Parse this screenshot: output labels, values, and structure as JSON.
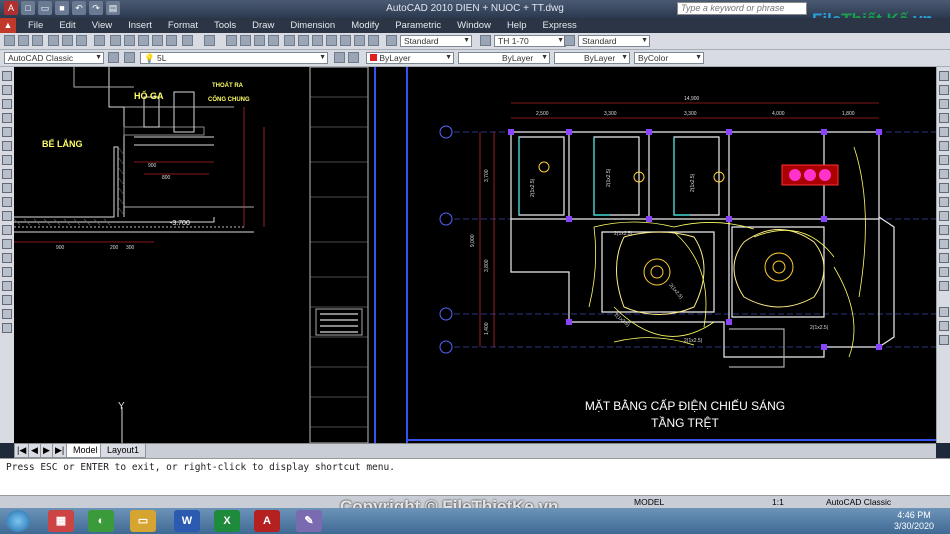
{
  "window": {
    "title": "AutoCAD 2010    DIEN + NUOC + TT.dwg",
    "search_placeholder": "Type a keyword or phrase",
    "logo_part1": "File",
    "logo_part2": "Thiết Kế",
    "logo_part3": ".vn"
  },
  "menu": {
    "items": [
      "File",
      "Edit",
      "View",
      "Insert",
      "Format",
      "Tools",
      "Draw",
      "Dimension",
      "Modify",
      "Parametric",
      "Window",
      "Help",
      "Express"
    ]
  },
  "toolbar2": {
    "text_style": "Standard",
    "dim_style": "TH 1-70",
    "table_style": "Standard"
  },
  "toolbar3": {
    "workspace": "AutoCAD Classic",
    "layer": "5L",
    "color": "ByLayer",
    "linetype": "ByLayer",
    "lineweight": "ByLayer",
    "plotstyle": "ByColor"
  },
  "drawing_left": {
    "label_hoga": "HỐ GA",
    "label_thoat": "THOÁT RA",
    "label_cong": "CỐNG CHUNG",
    "label_belang": "BỂ LẮNG",
    "dim_900a": "900",
    "dim_800": "800",
    "dim_900b": "900",
    "dim_200": "200",
    "dim_300": "300",
    "level": "-3.700"
  },
  "drawing_right": {
    "title_line1": "MẶT BẰNG CẤP ĐIỆN CHIẾU SÁNG",
    "title_line2": "TẦNG TRỆT",
    "dim_total": "14,900",
    "dims_top": [
      "2,500",
      "3,300",
      "3,300",
      "4,000",
      "1,800"
    ],
    "dims_left": [
      "3,700",
      "3,800",
      "1,400"
    ],
    "dim_left_total": "9,000",
    "wire_labels": [
      "2(1x2.5)",
      "2(1x2.5)",
      "2(1x2.5)",
      "2(1x2.5)",
      "2(1x2.5)",
      "2(1x2.5)",
      "2(1x2.5)",
      "2(1x2.5)"
    ]
  },
  "tabs": {
    "model": "Model",
    "layout1": "Layout1"
  },
  "command": {
    "prompt": "Press ESC or ENTER to exit, or right-click to display shortcut menu."
  },
  "status": {
    "model": "MODEL",
    "scale": "1:1",
    "workspace": "AutoCAD Classic"
  },
  "watermark": "Copyright © FileThietKe.vn",
  "taskbar": {
    "time": "4:46 PM",
    "date": "3/30/2020"
  },
  "colors": {
    "canvas": "#000000",
    "wall": "#ffffff",
    "dim": "#ff3333",
    "grid_axis": "#5566ff",
    "light": "#ffcc33",
    "wire": "#ffff66"
  }
}
